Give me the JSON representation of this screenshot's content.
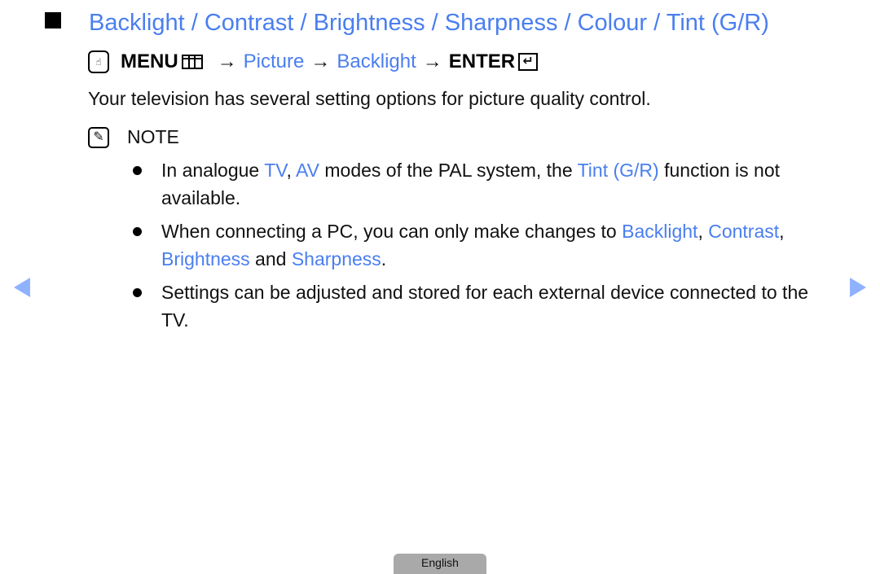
{
  "title": "Backlight / Contrast / Brightness / Sharpness / Colour / Tint (G/R)",
  "menu_path": {
    "icon_remote": "remote-hand-icon",
    "menu": "MENU",
    "arrow": "→",
    "picture": "Picture",
    "backlight": "Backlight",
    "enter": "ENTER",
    "enter_glyph": "↵"
  },
  "intro": "Your television has several setting options for picture quality control.",
  "note_label": "NOTE",
  "note_glyph": "✎",
  "bullets": {
    "b1": {
      "t1": "In analogue ",
      "h1": "TV",
      "t2": ", ",
      "h2": "AV",
      "t3": " modes of the PAL system, the ",
      "h3": "Tint (G/R)",
      "t4": " function is not available."
    },
    "b2": {
      "t1": "When connecting a PC, you can only make changes to ",
      "h1": "Backlight",
      "t2": ", ",
      "h2": "Contrast",
      "t3": ", ",
      "h3": "Brightness",
      "t4": " and ",
      "h4": "Sharpness",
      "t5": "."
    },
    "b3": {
      "t1": "Settings can be adjusted and stored for each external device connected to the TV."
    }
  },
  "language_tab": "English",
  "colors": {
    "accent": "#4a7ef0",
    "nav_arrow": "#8fb2ff",
    "lang_tab": "#a9a9a9"
  }
}
